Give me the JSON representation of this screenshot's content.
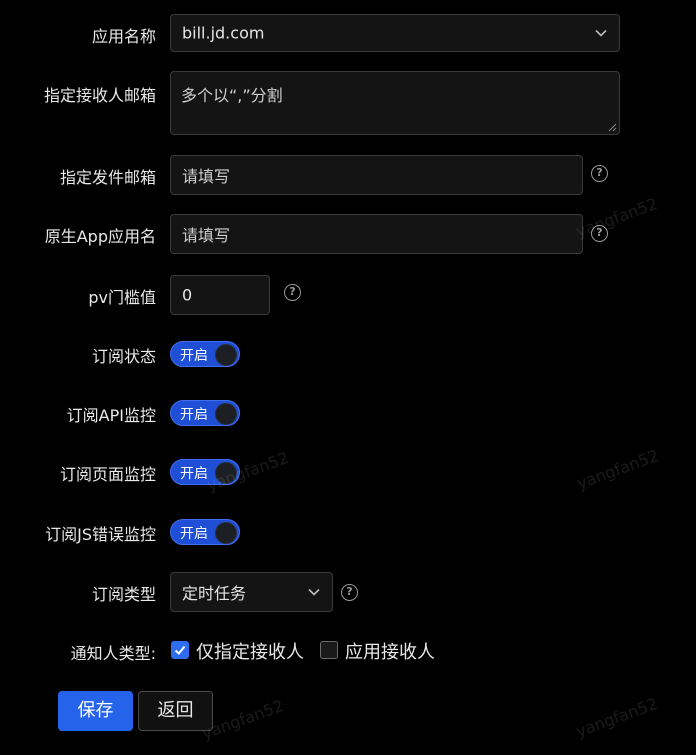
{
  "form": {
    "app_name": {
      "label": "应用名称",
      "value": "bill.jd.com"
    },
    "recipient_email": {
      "label": "指定接收人邮箱",
      "placeholder": "多个以“,”分割"
    },
    "sender_email": {
      "label": "指定发件邮箱",
      "placeholder": "请填写"
    },
    "native_app_name": {
      "label": "原生App应用名",
      "placeholder": "请填写"
    },
    "pv_threshold": {
      "label": "pv门槛值",
      "value": "0"
    },
    "subscribe_status": {
      "label": "订阅状态",
      "switch_text": "开启",
      "on": true
    },
    "subscribe_api": {
      "label": "订阅API监控",
      "switch_text": "开启",
      "on": true
    },
    "subscribe_page": {
      "label": "订阅页面监控",
      "switch_text": "开启",
      "on": true
    },
    "subscribe_js": {
      "label": "订阅JS错误监控",
      "switch_text": "开启",
      "on": true
    },
    "subscribe_type": {
      "label": "订阅类型",
      "value": "定时任务"
    },
    "notify_type": {
      "label": "通知人类型:",
      "options": [
        {
          "label": "仅指定接收人",
          "checked": true
        },
        {
          "label": "应用接收人",
          "checked": false
        }
      ]
    }
  },
  "buttons": {
    "save": "保存",
    "back": "返回"
  },
  "help_glyph": "?",
  "watermark_text": "yangfan52",
  "colors": {
    "accent": "#2563eb",
    "background": "#000000",
    "input_bg": "#141414"
  },
  "icons": {
    "select": "chevron-down-icon",
    "help": "help-circle-icon",
    "check": "check-icon"
  }
}
